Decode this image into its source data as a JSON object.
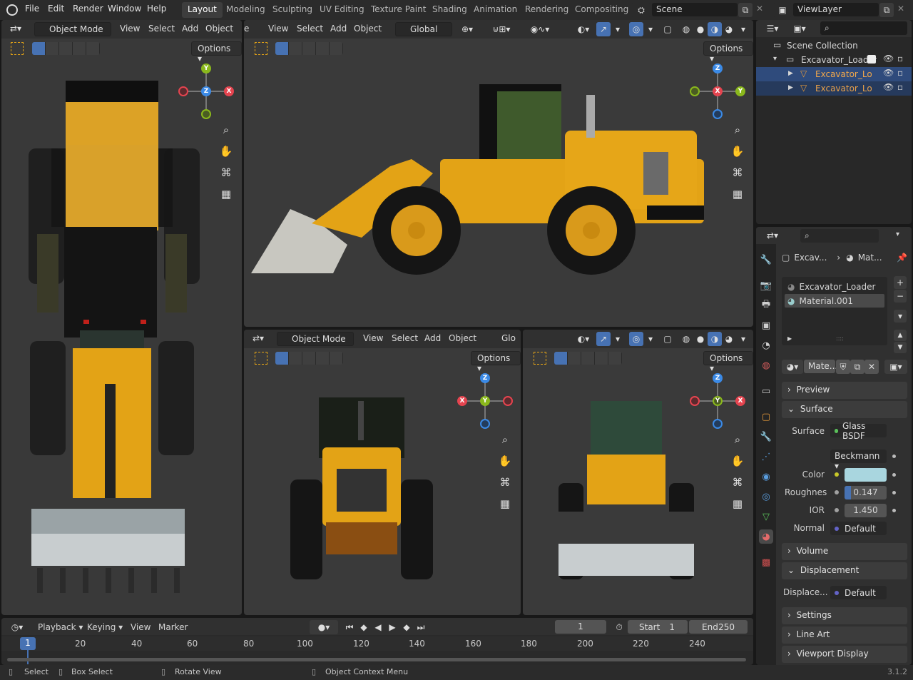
{
  "topbar": {
    "menus": [
      "File",
      "Edit",
      "Render",
      "Window",
      "Help"
    ],
    "workspaces": [
      "Layout",
      "Modeling",
      "Sculpting",
      "UV Editing",
      "Texture Paint",
      "Shading",
      "Animation",
      "Rendering",
      "Compositing"
    ],
    "active_workspace": "Layout",
    "scene": "Scene",
    "view_layer": "ViewLayer"
  },
  "viewport_left": {
    "mode": "Object Mode",
    "menus": [
      "View",
      "Select",
      "Add",
      "Object"
    ],
    "options": "Options",
    "gizmo": {
      "top": "Y",
      "center": "Z",
      "right": "X"
    }
  },
  "viewport_top": {
    "menus": [
      "View",
      "Select",
      "Add",
      "Object"
    ],
    "partial_menu": "e",
    "transform": "Global",
    "options": "Options",
    "gizmo": {
      "top": "Z",
      "center": "X",
      "right": "Y"
    }
  },
  "viewport_front": {
    "mode": "Object Mode",
    "menus": [
      "View",
      "Select",
      "Add",
      "Object"
    ],
    "transform_partial": "Glo",
    "options": "Options",
    "gizmo": {
      "top": "Z",
      "center": "Y",
      "left": "X"
    }
  },
  "viewport_back": {
    "options": "Options",
    "gizmo": {
      "top": "Z",
      "center": "Y",
      "right": "X"
    }
  },
  "outliner": {
    "root": "Scene Collection",
    "collection": "Excavator_Loader",
    "objects": [
      "Excavator_Lo",
      "Excavator_Lo"
    ]
  },
  "properties": {
    "breadcrumb_object": "Excav...",
    "breadcrumb_material": "Mat...",
    "slots": [
      "Excavator_Loader",
      "Material.001"
    ],
    "material_name": "Mate...",
    "panels": {
      "preview": "Preview",
      "surface": "Surface",
      "volume": "Volume",
      "displacement": "Displacement",
      "settings": "Settings",
      "line_art": "Line Art",
      "viewport_display": "Viewport Display"
    },
    "surface_label": "Surface",
    "surface_shader": "Glass BSDF",
    "distribution": "Beckmann",
    "color_label": "Color",
    "color_value": "#a9d6df",
    "roughness_label": "Roughnes",
    "roughness": "0.147",
    "roughness_level": 0.147,
    "ior_label": "IOR",
    "ior": "1.450",
    "normal_label": "Normal",
    "normal": "Default",
    "displacement_label": "Displace...",
    "displacement": "Default"
  },
  "timeline": {
    "menus": [
      "Playback",
      "Keying",
      "View",
      "Marker"
    ],
    "current_frame": "1",
    "start_label": "Start",
    "start": "1",
    "end_label": "End",
    "end": "250",
    "ticks": [
      "20",
      "40",
      "60",
      "80",
      "100",
      "120",
      "140",
      "160",
      "180",
      "200",
      "220",
      "240"
    ],
    "playhead": "1"
  },
  "statusbar": {
    "items": [
      "Select",
      "Box Select",
      "Rotate View",
      "Object Context Menu"
    ],
    "version": "3.1.2"
  },
  "colors": {
    "accent": "#4772b3",
    "yellow": "#e3a316",
    "axis_x": "#e5444f",
    "axis_y": "#8ab81c",
    "axis_z": "#3b8ae6"
  }
}
